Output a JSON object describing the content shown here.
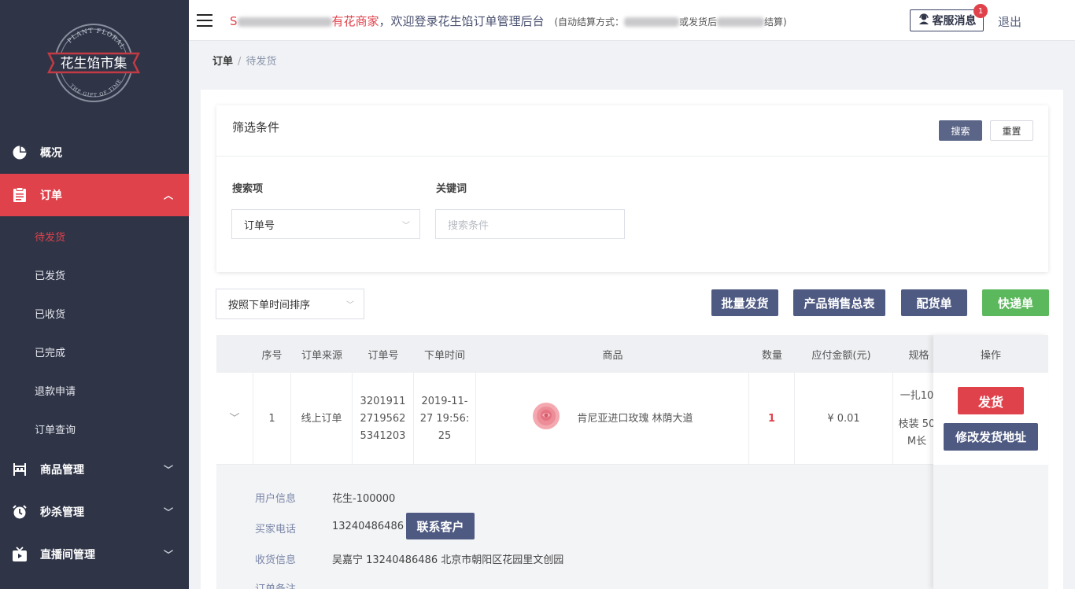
{
  "header": {
    "welcome_prefix": "S",
    "welcome_red": "有花商家",
    "welcome_main": "，欢迎登录花生馅订单管理后台",
    "settlement_label": "(自动结算方式：",
    "settlement_mid": "或发货后",
    "settlement_end": "结算)",
    "cs_label": "客服消息",
    "cs_badge": "1",
    "logout": "退出"
  },
  "logo": {
    "name": "花生馅市集",
    "top_arc": "PLANT FLORAL",
    "bottom_arc": "THE GIFT OF TIME"
  },
  "sidebar": {
    "items": [
      {
        "label": "概况",
        "icon": "pie-chart-icon"
      },
      {
        "label": "订单",
        "icon": "clipboard-icon",
        "chevron": "^"
      },
      {
        "label": "商品管理",
        "icon": "shelf-icon",
        "chevron": "v"
      },
      {
        "label": "秒杀管理",
        "icon": "alarm-clock-icon",
        "chevron": "v"
      },
      {
        "label": "直播间管理",
        "icon": "tv-icon",
        "chevron": "v"
      }
    ],
    "sub_items": [
      "待发货",
      "已发货",
      "已收货",
      "已完成",
      "退款申请",
      "订单查询"
    ]
  },
  "breadcrumb": {
    "root": "订单",
    "sep": "/",
    "current": "待发货"
  },
  "filter": {
    "title": "筛选条件",
    "search_btn": "搜索",
    "reset_btn": "重置",
    "search_item_label": "搜索项",
    "search_item_value": "订单号",
    "keyword_label": "关键词",
    "keyword_placeholder": "搜索条件"
  },
  "toolbar": {
    "sort_value": "按照下单时间排序",
    "batch_ship": "批量发货",
    "sales_summary": "产品销售总表",
    "distribution": "配货单",
    "express": "快递单"
  },
  "table": {
    "headers": [
      "序号",
      "订单来源",
      "订单号",
      "下单时间",
      "商品",
      "数量",
      "应付金额(元)",
      "规格",
      "操作"
    ],
    "row": {
      "index": "1",
      "source": "线上订单",
      "order_no_1": "3201911",
      "order_no_2": "2719562",
      "order_no_3": "5341203",
      "time_1": "2019-11-",
      "time_2": "27 19:56:",
      "time_3": "25",
      "product": "肯尼亚进口玫瑰 林荫大道",
      "quantity": "1",
      "amount": "¥ 0.01",
      "spec_1": "一扎10",
      "spec_2": "枝装 50",
      "spec_3": "M长",
      "ship_btn": "发货",
      "edit_addr_btn": "修改发货地址"
    },
    "detail": {
      "user_label": "用户信息",
      "user_value": "花生-100000",
      "phone_label": "买家电话",
      "phone_value": "13240486486",
      "contact_btn": "联系客户",
      "receive_label": "收货信息",
      "receive_value": "吴嘉宁 13240486486 北京市朝阳区花园里文创园",
      "remark_label": "订单备注"
    }
  },
  "colors": {
    "sidebar_bg": "#2f3447",
    "accent_red": "#e0424b",
    "button_blue": "#4e5a82",
    "button_green": "#5cb85c"
  }
}
